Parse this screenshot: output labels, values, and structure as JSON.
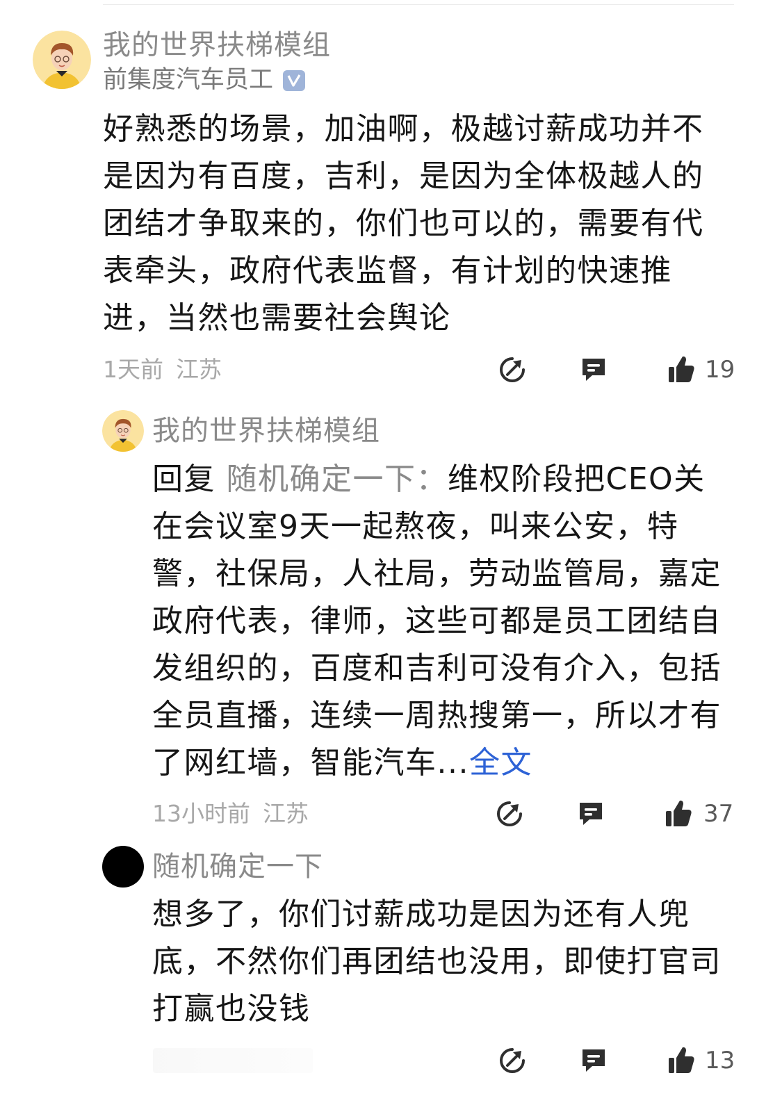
{
  "comments": [
    {
      "username": "我的世界扶梯模组",
      "subtitle": "前集度汽车员工",
      "verified_icon": "verified-v-icon",
      "body": "好熟悉的场景，加油啊，极越讨薪成功并不是因为有百度，吉利，是因为全体极越人的团结才争取来的，你们也可以的，需要有代表牵头，政府代表监督，有计划的快速推进，当然也需要社会舆论",
      "time": "1天前",
      "location": "江苏",
      "like_count": "19"
    },
    {
      "username": "我的世界扶梯模组",
      "reply_prefix": "回复 ",
      "reply_target": "随机确定一下",
      "reply_colon": "：",
      "body": "维权阶段把CEO关在会议室9天一起熬夜，叫来公安，特警，社保局，人社局，劳动监管局，嘉定政府代表，律师，这些可都是员工团结自发组织的，百度和吉利可没有介入，包括全员直播，连续一周热搜第一，所以才有了网红墙，智能汽车...",
      "fulltext_link": "全文",
      "time": "13小时前",
      "location": "江苏",
      "like_count": "37"
    },
    {
      "username": "随机确定一下",
      "body": "想多了，你们讨薪成功是因为还有人兜底，不然你们再团结也没用，即使打官司打赢也没钱",
      "like_count": "13"
    }
  ],
  "icons": {
    "share": "share-icon",
    "reply": "comment-bubble-icon",
    "like": "thumbs-up-icon"
  },
  "colors": {
    "username": "#8a8a8a",
    "link": "#2e63d6",
    "meta": "#a8a8a8",
    "icon": "#2f2f2f"
  }
}
